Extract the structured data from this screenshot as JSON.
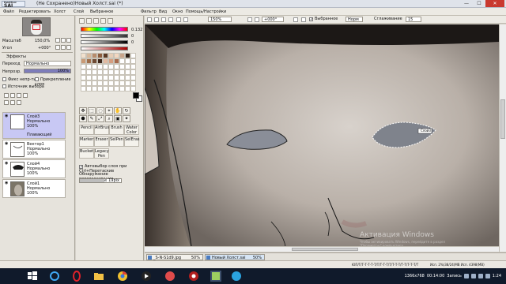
{
  "window": {
    "app_logo": "SAI",
    "app_logo_top": "PaintTool",
    "title": "(Не Сохранено)Новый Холст.sai (*)",
    "minimize": "—",
    "maximize": "☐",
    "close": "✕"
  },
  "menu": [
    "Файл",
    "Редактировать",
    "Холст",
    "Слой",
    "Выбранное",
    "Фильтр",
    "Вид",
    "Окно",
    "Помощь/Настройки"
  ],
  "navigator": {
    "zoom_label": "Масштаб",
    "zoom_value": "150,0%",
    "angle_label": "Угол",
    "angle_value": "+000°"
  },
  "layer_settings": {
    "effects_label": "Эффекты",
    "mode_label": "Переход",
    "mode_value": "Нормально",
    "opacity_label": "Непрозр.",
    "opacity_value": "100%",
    "opacity_fraction": 1.0,
    "fix_opacity": "Фикс непр-ть",
    "clip_layer": "Прикрепление слоя",
    "selection_source": "Источник выбора"
  },
  "layers": [
    {
      "name": "Слой3",
      "mode": "Нормально",
      "opacity": "100%",
      "sub": "Плавающий",
      "selected": true
    },
    {
      "name": "Вектор1",
      "mode": "Нормально",
      "opacity": "100%",
      "selected": false
    },
    {
      "name": "Слой4",
      "mode": "Нормально",
      "opacity": "100%",
      "selected": false
    },
    {
      "name": "Слой1",
      "mode": "Нормально",
      "opacity": "100%",
      "selected": false
    }
  ],
  "color": {
    "hsv": [
      {
        "value": "0.132"
      },
      {
        "value": "0"
      },
      {
        "value": "0"
      }
    ],
    "swatches": [
      "#f1e0cd",
      "#d6b79a",
      "#b78c6c",
      "#8e5e3e",
      "#5b3a25",
      "#e7cdb6",
      "#f3d7c0",
      "#c9a48a",
      "#2b1c14",
      "#ffffff",
      "#c99a75",
      "#9f6e4a",
      "#6e4a32",
      "#3d271a",
      "#e2b9a0",
      "#d59d7e",
      "#a86b4d",
      "#ffffff",
      "#ffffff",
      "#ffffff",
      "#ffffff",
      "#ffffff",
      "#ffffff",
      "#ffffff",
      "#ffffff",
      "#ffffff",
      "#ffffff",
      "#ffffff",
      "#ffffff",
      "#ffffff",
      "#ffffff",
      "#ffffff",
      "#ffffff",
      "#ffffff",
      "#ffffff",
      "#ffffff",
      "#ffffff",
      "#ffffff",
      "#ffffff",
      "#ffffff",
      "#ffffff",
      "#ffffff",
      "#ffffff",
      "#ffffff",
      "#ffffff",
      "#ffffff",
      "#ffffff",
      "#ffffff",
      "#ffffff",
      "#ffffff",
      "#ffffff",
      "#ffffff",
      "#ffffff",
      "#ffffff",
      "#ffffff",
      "#ffffff",
      "#ffffff",
      "#ffffff",
      "#ffffff",
      "#ffffff",
      "#ffffff",
      "#ffffff",
      "#ffffff",
      "#ffffff",
      "#ffffff",
      "#ffffff",
      "#ffffff",
      "#ffffff",
      "#ffffff",
      "#ffffff"
    ]
  },
  "tools": {
    "icons": [
      "✥",
      "⬚",
      "◌",
      "⌖",
      "✋",
      "↻",
      "⬢",
      "✎",
      "⤢",
      "⌕",
      "▣",
      "✦"
    ],
    "brushes": [
      {
        "label": "Pencil"
      },
      {
        "label": "AirBrush"
      },
      {
        "label": "Brush"
      },
      {
        "label": "Water Color"
      },
      {
        "label": "Marker"
      },
      {
        "label": "Eraser"
      },
      {
        "label": "SelPen"
      },
      {
        "label": "SelEras"
      },
      {
        "label": "Bucket"
      },
      {
        "label": "Legacy Pen"
      },
      {
        "label": ""
      },
      {
        "label": ""
      }
    ],
    "auto_select": "Автовыбор слоя при Ctrl+Перетаскив",
    "feedback_label": "Обнаружение перетаскивания",
    "feedback_value": "≤ 19pix"
  },
  "canvas_toolbar": {
    "zoom": "150%",
    "angle": "+000°",
    "selected_label": "Выбранное",
    "mode": "Норм",
    "stabilizer_label": "Сглаживание",
    "stabilizer_value": "15"
  },
  "canvas": {
    "selection_label": "Слой3"
  },
  "document_tabs": [
    {
      "name": "_S-N-S1d9.jpg",
      "zoom": "50%",
      "active": false
    },
    {
      "name": "Новый Холст.sai",
      "zoom": "50%",
      "active": true
    }
  ],
  "status": {
    "memory": "ЮП/Т/Т-Т-Т-Т-Т/Т/Т-Т-Т/Т/Т-Т-Т/Т-Т/Т-Т-Т/Т",
    "memory_right": "Исп. 2%(38/24)MB Исп. 4398(MB)",
    "resolution": "1366x768",
    "timer": "00:14:00",
    "recording": "Запись",
    "watermark_title": "Активация Windows",
    "watermark_text": "Чтобы активировать Windows, перейдите в раздел \"Параметры\" компьютера."
  },
  "taskbar": {
    "clock": "1:24"
  }
}
